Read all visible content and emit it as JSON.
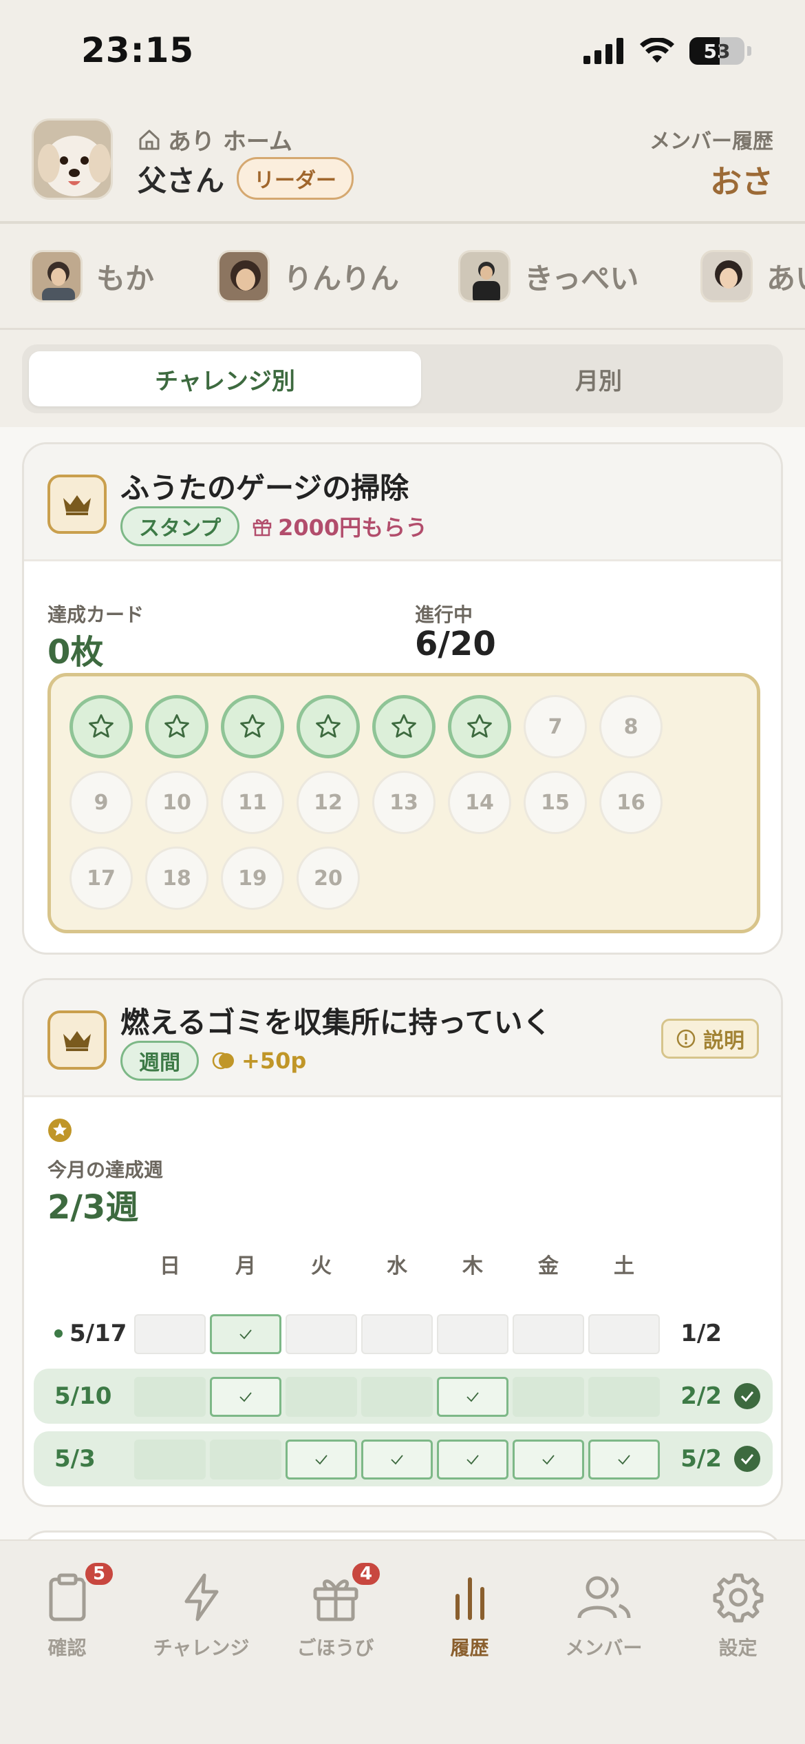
{
  "status_bar": {
    "time": "23:15",
    "battery": "53"
  },
  "header": {
    "home_name": "あり ホーム",
    "user_name": "父さん",
    "role_badge": "リーダー",
    "member_history_label": "メンバー履歴",
    "member_history_value": "おさ"
  },
  "members": [
    {
      "name": "もか"
    },
    {
      "name": "りんりん"
    },
    {
      "name": "きっぺい"
    },
    {
      "name": "あい"
    }
  ],
  "tabs": [
    {
      "label": "チャレンジ別",
      "active": true
    },
    {
      "label": "月別",
      "active": false
    }
  ],
  "challenges": [
    {
      "title": "ふうたのゲージの掃除",
      "type_badge": "スタンプ",
      "reward": "2000円もらう",
      "stat1_label": "達成カード",
      "stat1_value": "0枚",
      "stat2_label": "進行中",
      "stat2_value": "6/20",
      "stamps_done": 6,
      "stamps_total": 20,
      "stamp_labels": [
        "7",
        "8",
        "9",
        "10",
        "11",
        "12",
        "13",
        "14",
        "15",
        "16",
        "17",
        "18",
        "19",
        "20"
      ]
    },
    {
      "title": "燃えるゴミを収集所に持っていく",
      "type_badge": "週間",
      "points": "+50p",
      "explain_button": "説明",
      "stat_label": "今月の達成週",
      "stat_value": "2/3週",
      "weekdays": [
        "日",
        "月",
        "火",
        "水",
        "木",
        "金",
        "土"
      ],
      "weeks": [
        {
          "label": "5/17",
          "current": true,
          "checks": [
            false,
            true,
            false,
            false,
            false,
            false,
            false
          ],
          "count": "1/2",
          "achieved": false
        },
        {
          "label": "5/10",
          "current": false,
          "checks": [
            false,
            true,
            false,
            false,
            true,
            false,
            false
          ],
          "count": "2/2",
          "achieved": true
        },
        {
          "label": "5/3",
          "current": false,
          "checks": [
            false,
            false,
            true,
            true,
            true,
            true,
            true
          ],
          "count": "5/2",
          "achieved": true
        }
      ]
    }
  ],
  "bottom_nav": [
    {
      "label": "確認",
      "icon": "clipboard-icon",
      "badge": "5",
      "active": false
    },
    {
      "label": "チャレンジ",
      "icon": "lightning-icon",
      "badge": "",
      "active": false
    },
    {
      "label": "ごほうび",
      "icon": "gift-icon",
      "badge": "4",
      "active": false
    },
    {
      "label": "履歴",
      "icon": "bar-chart-icon",
      "badge": "",
      "active": true
    },
    {
      "label": "メンバー",
      "icon": "users-icon",
      "badge": "",
      "active": false
    },
    {
      "label": "設定",
      "icon": "gear-icon",
      "badge": "",
      "active": false
    }
  ],
  "colors": {
    "accent_green": "#3d6a3f",
    "accent_brown": "#9c6a36",
    "reward_pink": "#b24d6c",
    "gold": "#c09628"
  }
}
